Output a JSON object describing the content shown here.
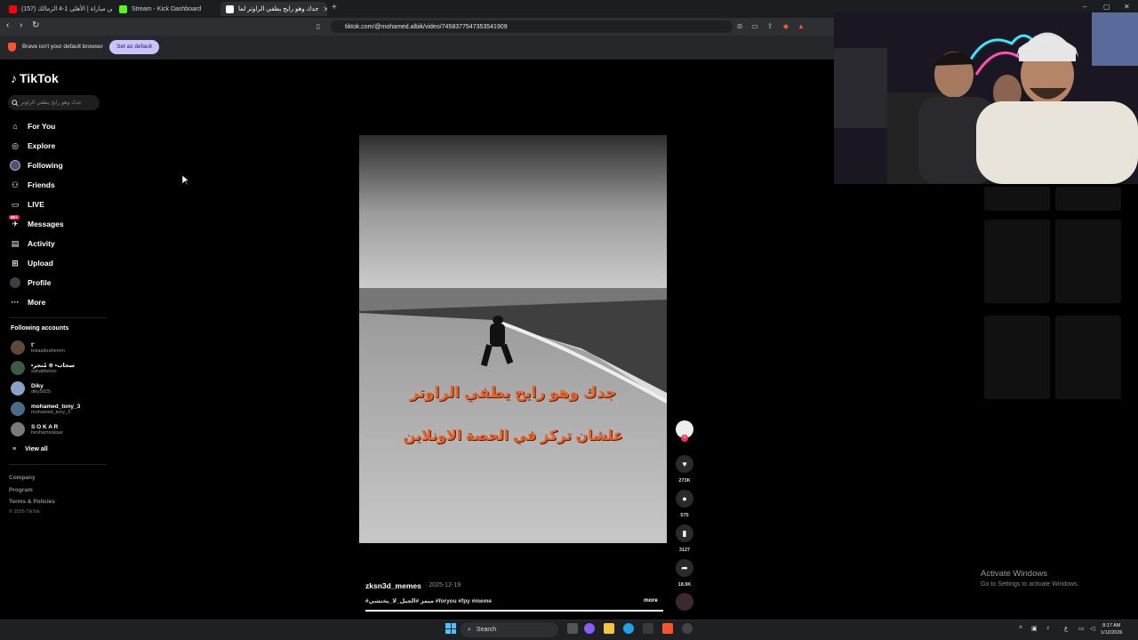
{
  "browser": {
    "tabs": [
      {
        "label": "(157) ملخص مباراة | الأهلي 1-4 الزمالك",
        "color": "#ff0000"
      },
      {
        "label": "Stream - Kick Dashboard",
        "color": "#53fc18"
      },
      {
        "label": "جدك وهو رايح يطفي الراوتر لما",
        "color": "#ffffff"
      }
    ],
    "new_tab": "+",
    "url": "tiktok.com/@mohamed.albik/video/7458377547353541909",
    "infobar_text": "Brave isn't your default browser",
    "set_default_label": "Set as default",
    "window_controls": [
      "–",
      "▢",
      "✕"
    ]
  },
  "tiktok": {
    "logo_text": "TikTok",
    "search_placeholder": "جدك وهو رايح يطفي الراوتر",
    "nav": [
      {
        "label": "For You",
        "icon": "home-icon"
      },
      {
        "label": "Explore",
        "icon": "compass-icon"
      },
      {
        "label": "Following",
        "icon": "following-icon"
      },
      {
        "label": "Friends",
        "icon": "friends-icon"
      },
      {
        "label": "LIVE",
        "icon": "live-icon"
      },
      {
        "label": "Messages",
        "icon": "messages-icon",
        "badge": "99+"
      },
      {
        "label": "Activity",
        "icon": "activity-icon"
      },
      {
        "label": "Upload",
        "icon": "upload-icon"
      },
      {
        "label": "Profile",
        "icon": "profile-icon"
      },
      {
        "label": "More",
        "icon": "more-icon"
      }
    ],
    "following_heading": "Following accounts",
    "accounts": [
      {
        "name": "t'",
        "handle": "tokaaibrahemm"
      },
      {
        "name": "•سحاب• ⊕ مُتجر",
        "handle": "sahabfstore"
      },
      {
        "name": "Diky",
        "handle": "diky5825"
      },
      {
        "name": "mohamed_tony_3",
        "handle": "mohamed_tony_3"
      },
      {
        "name": "S O K A R",
        "handle": "heshamsokaar"
      }
    ],
    "view_all": "View all",
    "footer_links": [
      "Company",
      "Program",
      "Terms & Policies"
    ],
    "copyright": "© 2026 TikTok",
    "video": {
      "caption_line1": "جدك وهو رايح يطفي الراوتر",
      "caption_line2": "علشان تركز في الحصة الاونلاين",
      "author": "zksn3d_memes",
      "date": "· 2025-12-19",
      "tags": "#ميمز #الجيل_لا_يختشي #foryou #fpy #meme",
      "more": "more",
      "likes": "273K",
      "comments": "575",
      "saves": "3127",
      "shares": "18.9K"
    }
  },
  "windows": {
    "activate_title": "Activate Windows",
    "activate_sub": "Go to Settings to activate Windows.",
    "search_label": "Search",
    "time": "8:17 AM",
    "date": "1/12/2026",
    "lang": "ع"
  },
  "colors": {
    "accent": "#fe2c55",
    "caption": "#e8622b",
    "setdef": "#c9c3ff"
  }
}
